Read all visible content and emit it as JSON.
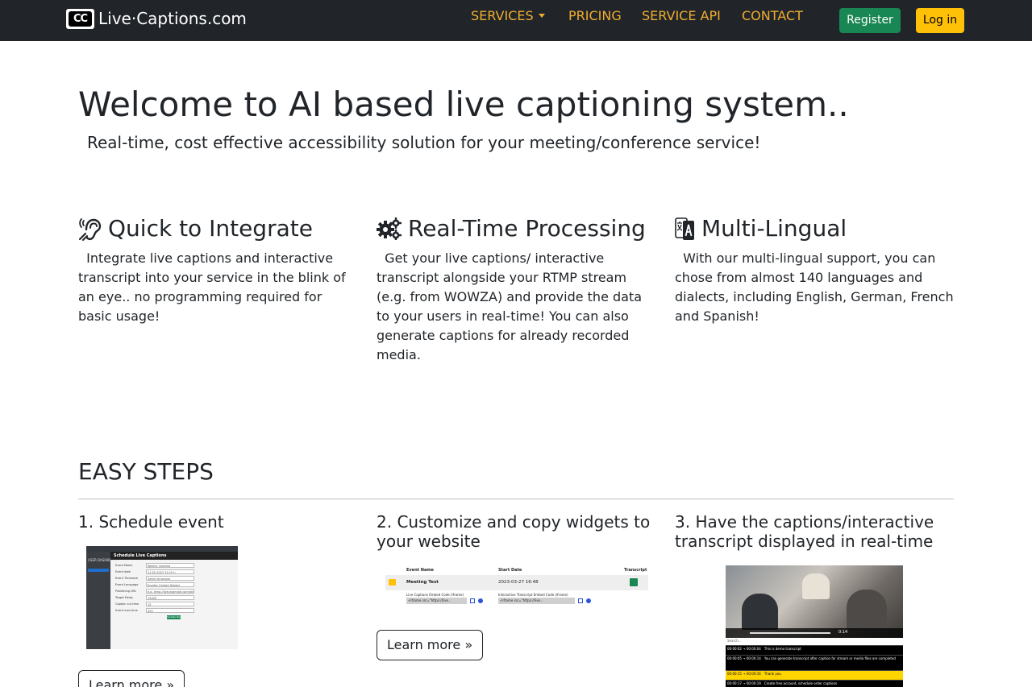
{
  "navbar": {
    "brand": "Live·Captions.com",
    "logo_icon": "closed-captions-icon",
    "links": {
      "services": "SERVICES",
      "pricing": "PRICING",
      "service_api": "SERVICE API",
      "contact": "CONTACT"
    },
    "register_label": "Register",
    "login_label": "Log in",
    "colors": {
      "background": "#212529",
      "link": "#f0ad2e",
      "register": "#198754",
      "login": "#ffc107"
    }
  },
  "hero": {
    "title": "Welcome to AI based live captioning system..",
    "subtitle": "Real-time, cost effective accessibility solution for your meeting/conference service!"
  },
  "features": [
    {
      "icon": "ear-listen-icon",
      "title": "Quick to Integrate",
      "text": "Integrate live captions and interactive transcript into your service in the blink of an eye.. no programming required for basic usage!"
    },
    {
      "icon": "gears-icon",
      "title": "Real-Time Processing",
      "text": "Get your live captions/ interactive transcript alongside your RTMP stream (e.g. from WOWZA) and provide the data to your users in real-time! You can also generate captions for already recorded media."
    },
    {
      "icon": "translate-icon",
      "title": "Multi-Lingual",
      "text": "With our multi-lingual support, you can chose from almost 140 languages and dialects, including English, German, French and Spanish!"
    }
  ],
  "steps": {
    "title": "EASY STEPS",
    "items": [
      {
        "title": "1. Schedule event",
        "learn_more": "Learn more »"
      },
      {
        "title": "2. Customize and copy widgets to your website",
        "learn_more": "Learn more »"
      },
      {
        "title": "3. Have the captions/interactive transcript displayed in real-time"
      }
    ]
  },
  "screenshots": {
    "schedule": {
      "header": "Schedule Live Captions",
      "sidebar_label": "USER DASHBOARD",
      "fields": [
        {
          "label": "Event Name",
          "value": "Weekly meeting"
        },
        {
          "label": "Event date",
          "value": "11.01.2023 12:15 h"
        },
        {
          "label": "Event Timezone",
          "value": "Select timezone"
        },
        {
          "label": "Event Language",
          "value": "English (United States)"
        },
        {
          "label": "Publishing URL",
          "value": "e.g. rtmp://live.example.com/stream"
        },
        {
          "label": "Target Delay",
          "value": "15000"
        },
        {
          "label": "Caption cut time",
          "value": "15"
        },
        {
          "label": "Event max time",
          "value": "450"
        }
      ],
      "button": "Update Delay"
    },
    "widgets": {
      "headers": [
        "Event Name",
        "Start Date",
        "Transcript"
      ],
      "row_name": "Meeting Test",
      "row_date": "2023-03-27 16:48",
      "embed_label_1": "Live Captions Embed Code (iframe)",
      "embed_label_2": "Interactive Transcript Embed Code (iframe)",
      "embed_value_1": "<iframe src=\"https://live...",
      "embed_value_2": "<iframe src=\"https://live..."
    },
    "player": {
      "search_label": "Search...",
      "time": "0:14",
      "transcript": [
        {
          "time": "00:00:02 → 00:00:04",
          "text": "This is demo transcript"
        },
        {
          "time": "00:00:05 → 00:00:14",
          "text": "You can generate transcript after caption for stream or media files are completed"
        },
        {
          "time": "00:00:15 → 00:00:16",
          "text": "Thank you",
          "active": true
        },
        {
          "time": "00:00:17 → 00:00:19",
          "text": "Create free account, schedule order captions"
        }
      ]
    }
  }
}
